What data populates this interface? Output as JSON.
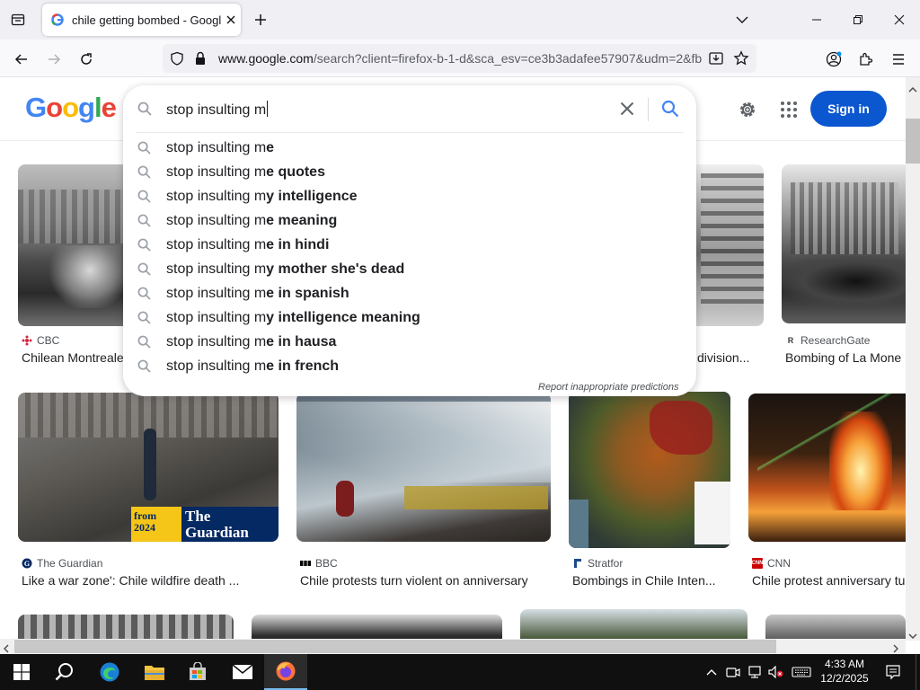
{
  "browser": {
    "tab_title": "chile getting bombed - Google",
    "url_prefix": "www.google.com",
    "url_rest": "/search?client=firefox-b-1-d&sca_esv=ce3b3adafee57907&udm=2&fb"
  },
  "google": {
    "logo_text": "Google",
    "sign_in_label": "Sign in"
  },
  "search": {
    "query": "stop insulting m",
    "suggestions": [
      {
        "prefix": "stop insulting m",
        "completion": "e"
      },
      {
        "prefix": "stop insulting m",
        "completion": "e quotes"
      },
      {
        "prefix": "stop insulting m",
        "completion": "y intelligence"
      },
      {
        "prefix": "stop insulting m",
        "completion": "e meaning"
      },
      {
        "prefix": "stop insulting m",
        "completion": "e in hindi"
      },
      {
        "prefix": "stop insulting m",
        "completion": "y mother she's dead"
      },
      {
        "prefix": "stop insulting m",
        "completion": "e in spanish"
      },
      {
        "prefix": "stop insulting m",
        "completion": "y intelligence meaning"
      },
      {
        "prefix": "stop insulting m",
        "completion": "e in hausa"
      },
      {
        "prefix": "stop insulting m",
        "completion": "e in french"
      }
    ],
    "report_label": "Report inappropriate predictions"
  },
  "results": {
    "row1": [
      {
        "source": "CBC",
        "caption": "Chilean Montreale"
      },
      {
        "source": "",
        "caption": "division..."
      },
      {
        "source": "ResearchGate",
        "caption": "Bombing of La Mone"
      }
    ],
    "row2": [
      {
        "source": "The Guardian",
        "caption": "Like a war zone': Chile wildfire death ...",
        "badge_year": "from 2024",
        "badge_brand": "The Guardian"
      },
      {
        "source": "BBC",
        "caption": "Chile protests turn violent on anniversary"
      },
      {
        "source": "Stratfor",
        "caption": "Bombings in Chile Inten..."
      },
      {
        "source": "CNN",
        "caption": "Chile protest anniversary tu"
      }
    ]
  },
  "taskbar": {
    "time": "4:33 AM",
    "date": "12/2/2025"
  }
}
